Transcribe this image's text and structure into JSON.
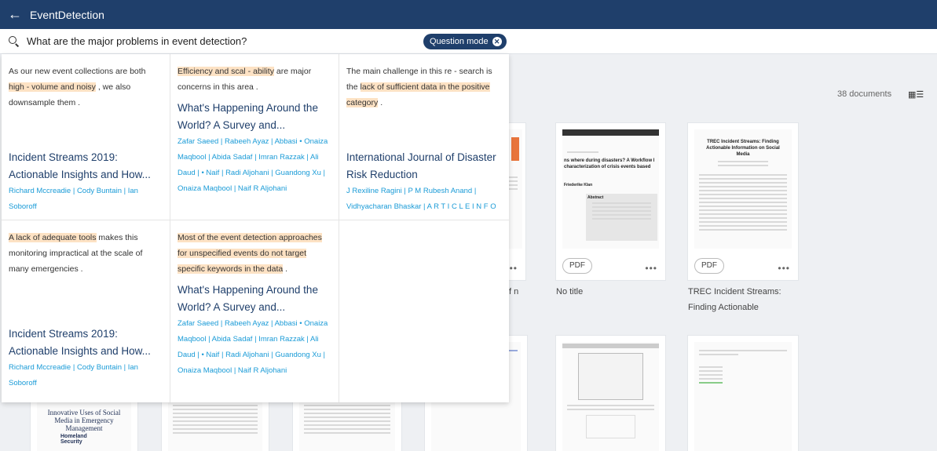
{
  "app": {
    "back_icon": "arrow-left-icon",
    "title": "EventDetection"
  },
  "search": {
    "icon": "search-icon",
    "query": "What are the major problems in event detection?",
    "mode_label": "Question mode"
  },
  "library": {
    "count_label": "38 documents"
  },
  "answers": [
    {
      "parts": [
        {
          "text": "As our new event collections are both ",
          "hl": false
        },
        {
          "text": "high - volume and noisy",
          "hl": true
        },
        {
          "text": " , we also downsample them .",
          "hl": false
        }
      ],
      "doc_title": "Incident Streams 2019: Actionable Insights and How...",
      "authors": "Richard Mccreadie | Cody Buntain | Ian Soboroff"
    },
    {
      "parts": [
        {
          "text": "Efficiency and scal - ability",
          "hl": true
        },
        {
          "text": " are major concerns in this area .",
          "hl": false
        }
      ],
      "doc_title": "What's Happening Around the World? A Survey and...",
      "authors": "Zafar Saeed | Rabeeh Ayaz | Abbasi • Onaiza Maqbool | Abida Sadaf | Imran Razzak | Ali Daud | • Naif | Radi Aljohani | Guandong Xu | Onaiza Maqbool | Naif R Aljohani"
    },
    {
      "parts": [
        {
          "text": "The main challenge in this re - search is the ",
          "hl": false
        },
        {
          "text": "lack of sufficient data in the positive category",
          "hl": true
        },
        {
          "text": " .",
          "hl": false
        }
      ],
      "doc_title": "International Journal of Disaster Risk Reduction",
      "authors": "J Rexiline Ragini | P M Rubesh Anand | Vidhyacharan Bhaskar | A R T I C L E I N F O"
    },
    {
      "parts": [
        {
          "text": "A lack of adequate tools",
          "hl": true
        },
        {
          "text": " makes this monitoring impractical at the scale of many emergencies .",
          "hl": false
        }
      ],
      "doc_title": "Incident Streams 2019: Actionable Insights and How...",
      "authors": "Richard Mccreadie | Cody Buntain | Ian Soboroff"
    },
    {
      "parts": [
        {
          "text": "Most of the event detection approaches for unspecified events do not target specific keywords in the data",
          "hl": true
        },
        {
          "text": " .",
          "hl": false
        }
      ],
      "doc_title": "What's Happening Around the World? A Survey and...",
      "authors": "Zafar Saeed | Rabeeh Ayaz | Abbasi • Onaiza Maqbool | Abida Sadaf | Imran Razzak | Ali Daud | • Naif | Radi Aljohani | Guandong Xu | Onaiza Maqbool | Naif R Aljohani"
    }
  ],
  "cards": [
    {
      "badge": "PDF",
      "more": "•••",
      "caption": "No title"
    },
    {
      "badge": "PDF",
      "more": "•••",
      "caption": "TREC Incident Streams: Finding Actionable"
    },
    {
      "more": "•••",
      "caption": "f n"
    }
  ],
  "thumbs": {
    "card1_heading": "ns where during disasters? A Workflow l characterization of crisis events based",
    "card1_author": "Friederike Klan",
    "card1_abstract_label": "Abstract",
    "card2_title": "TREC Incident Streams: Finding Actionable Information on Social Media",
    "bottom1_title": "Innovative Uses of Social Media in Emergency Management",
    "bottom1_logo": "Homeland Security"
  }
}
